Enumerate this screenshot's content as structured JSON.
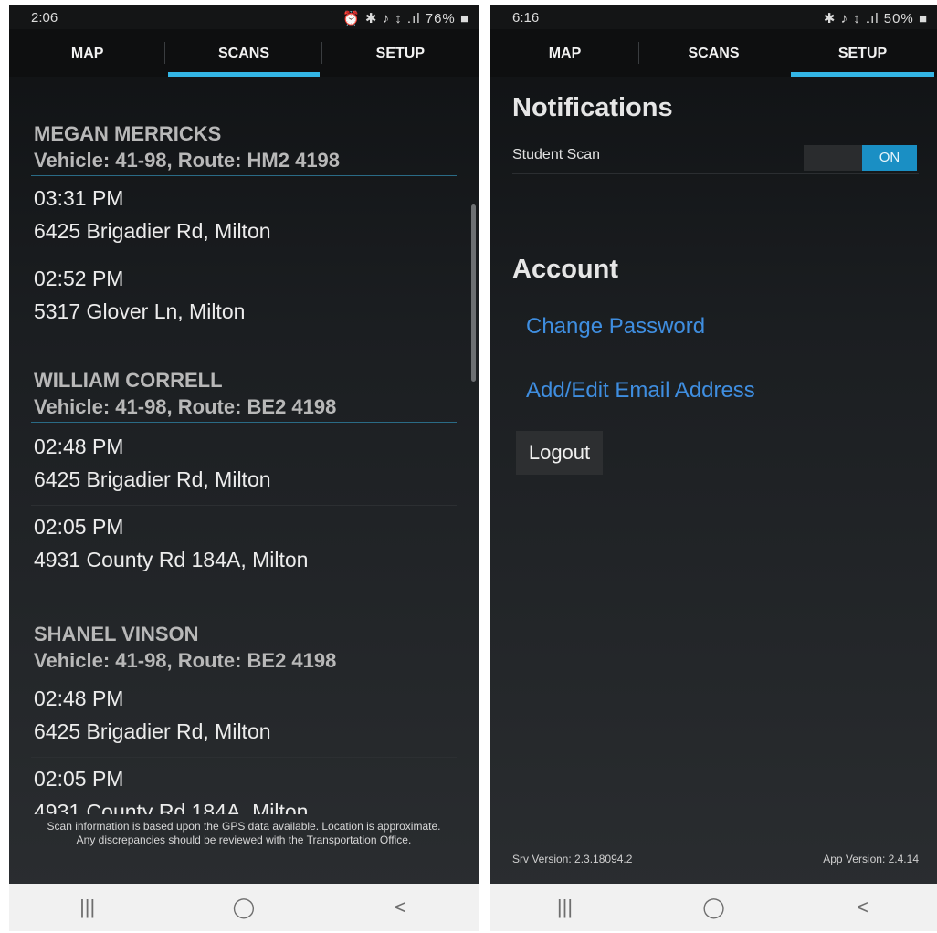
{
  "left": {
    "status": {
      "time": "2:06",
      "icons": "⏰ ✱ ♪ ↕ .ıl 76% ■"
    },
    "tabs": [
      {
        "label": "MAP"
      },
      {
        "label": "SCANS",
        "active": true
      },
      {
        "label": "SETUP"
      }
    ],
    "students": [
      {
        "name": "MEGAN MERRICKS",
        "vehicle": "Vehicle: 41-98, Route: HM2 4198",
        "scans": [
          {
            "time": "03:31 PM",
            "address": "6425 Brigadier Rd,  Milton"
          },
          {
            "time": "02:52 PM",
            "address": "5317 Glover Ln,  Milton"
          }
        ]
      },
      {
        "name": "WILLIAM CORRELL",
        "vehicle": "Vehicle: 41-98, Route: BE2 4198",
        "scans": [
          {
            "time": "02:48 PM",
            "address": "6425 Brigadier Rd,  Milton"
          },
          {
            "time": "02:05 PM",
            "address": "4931 County Rd 184A,  Milton"
          }
        ]
      },
      {
        "name": "SHANEL VINSON",
        "vehicle": "Vehicle: 41-98, Route: BE2 4198",
        "scans": [
          {
            "time": "02:48 PM",
            "address": "6425 Brigadier Rd,  Milton"
          },
          {
            "time": "02:05 PM",
            "address": "4931 County Rd 184A,  Milton"
          }
        ]
      }
    ],
    "footnote": "Scan information is based upon the GPS data available. Location is approximate. Any discrepancies should be reviewed with the Transportation Office."
  },
  "right": {
    "status": {
      "time": "6:16",
      "icons": "✱ ♪ ↕ .ıl 50% ■"
    },
    "tabs": [
      {
        "label": "MAP"
      },
      {
        "label": "SCANS"
      },
      {
        "label": "SETUP",
        "active": true
      }
    ],
    "notifications_title": "Notifications",
    "student_scan_label": "Student Scan",
    "student_scan_toggle": "ON",
    "account_title": "Account",
    "change_password": "Change Password",
    "add_edit_email": "Add/Edit Email Address",
    "logout": "Logout",
    "srv_version": "Srv Version: 2.3.18094.2",
    "app_version": "App Version: 2.4.14"
  },
  "navbar": {
    "recents": "|||",
    "home": "◯",
    "back": "<"
  },
  "colors": {
    "accent": "#33b5e5",
    "link": "#3f8ee0",
    "toggle_on": "#1a8fc4"
  },
  "icons": [
    "alarm-icon",
    "bluetooth-icon",
    "mute-icon",
    "data-icon",
    "signal-icon",
    "battery-icon",
    "recents-icon",
    "home-icon",
    "back-icon"
  ]
}
